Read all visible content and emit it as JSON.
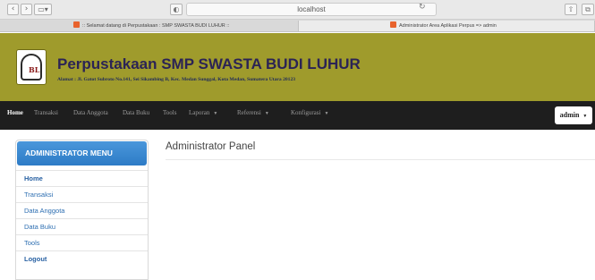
{
  "browser": {
    "back_icon": "chevron-left-icon",
    "forward_icon": "chevron-right-icon",
    "sidebar_icon": "sidebar-icon",
    "shield_icon": "shield-icon",
    "url": "localhost",
    "reload_icon": "reload-icon",
    "share_icon": "share-icon",
    "tabs_icon": "tabs-icon",
    "tabs": [
      {
        "label": ":: Selamat datang di Perpustakaan : SMP SWASTA BUDI LUHUR ::"
      },
      {
        "label": "Administrator Area Aplikasi Perpus => admin"
      }
    ]
  },
  "header": {
    "title": "Perpustakaan SMP SWASTA BUDI LUHUR",
    "address": "Alamat : Jl. Gatot Subroto No.141, Sei Sikambing B, Kec. Medan Sunggal, Kota Medan, Sumatera Utara 20123",
    "logo_text": "BL",
    "background": "#9f9b2c",
    "title_color": "#2b2355"
  },
  "navbar": {
    "items": [
      {
        "label": "Home"
      },
      {
        "label": "Transaksi"
      },
      {
        "label": "Data Anggota"
      },
      {
        "label": "Data Buku"
      },
      {
        "label": "Tools"
      },
      {
        "label": "Laporan"
      },
      {
        "label": "Referensi"
      },
      {
        "label": "Konfigurasi"
      }
    ],
    "user_label": "admin",
    "background": "#1e1e1e"
  },
  "sidebar": {
    "heading": "ADMINISTRATOR MENU",
    "items": [
      {
        "label": "Home"
      },
      {
        "label": "Transaksi"
      },
      {
        "label": "Data Anggota"
      },
      {
        "label": "Data Buku"
      },
      {
        "label": "Tools"
      },
      {
        "label": "Logout"
      }
    ],
    "accent": "#3586cf"
  },
  "main": {
    "title": "Administrator Panel"
  }
}
